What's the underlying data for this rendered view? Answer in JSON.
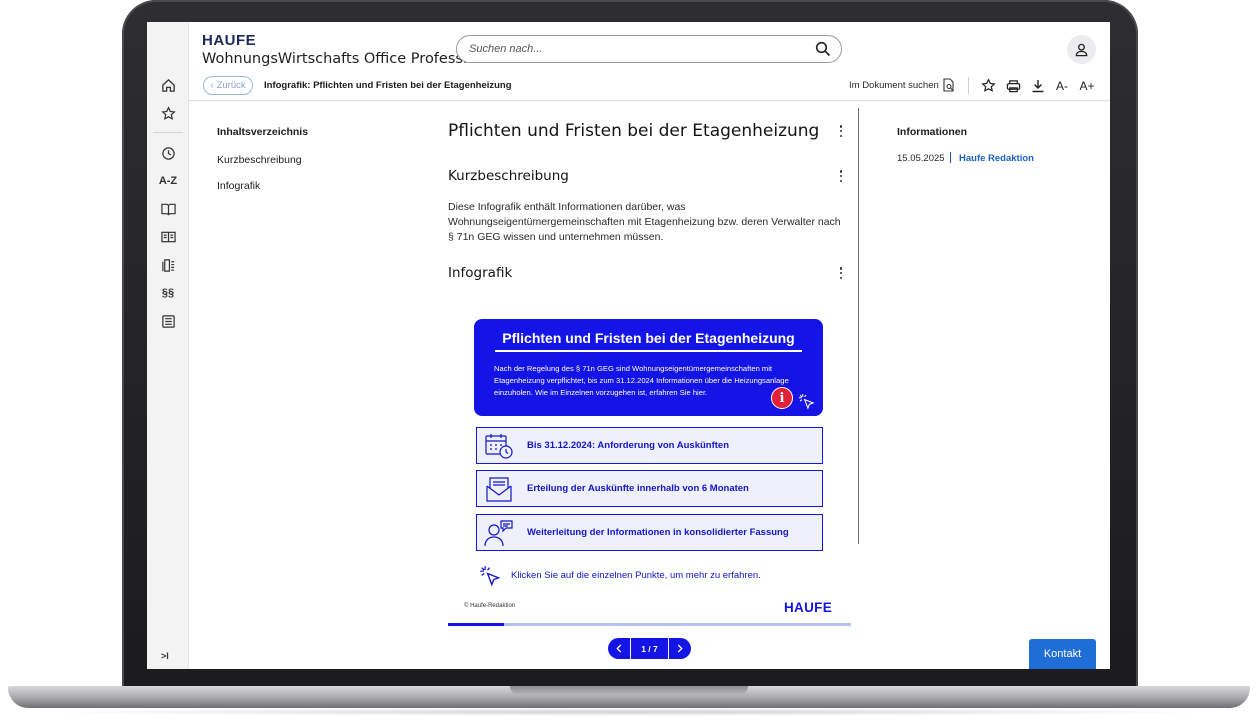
{
  "header": {
    "brand": "HAUFE",
    "product": "WohnungsWirtschafts Office Professional",
    "search_placeholder": "Suchen nach..."
  },
  "rail": {
    "items": [
      "home-icon",
      "star-icon",
      "history-icon",
      "A-Z",
      "book-icon",
      "book-image-icon",
      "document-list-icon",
      "§§",
      "archive-icon"
    ],
    "az_label": "A-Z",
    "paragraph_label": "§§",
    "collapse_label": ">I"
  },
  "toolbar": {
    "back_label": "Zurück",
    "breadcrumb": "Infografik: Pflichten und Fristen bei der Etagenheizung",
    "find_in_document": "Im Dokument suchen",
    "font_smaller": "A-",
    "font_larger": "A+"
  },
  "toc": {
    "title": "Inhaltsverzeichnis",
    "items": [
      "Kurzbeschreibung",
      "Infografik"
    ]
  },
  "article": {
    "title": "Pflichten und Fristen bei der Etagenheizung",
    "section1_title": "Kurzbeschreibung",
    "section1_text": "Diese Infografik enthält Informationen darüber, was Wohnungseigentümergemeinschaften mit Etagenheizung bzw. deren Verwalter nach § 71n GEG wissen und unternehmen müssen.",
    "section2_title": "Infografik"
  },
  "infographic": {
    "title": "Pflichten und Fristen bei der Etagenheizung",
    "intro": "Nach der Regelung des § 71n GEG sind Wohnungseigentümergemeinschaften mit Etagenheizung verpflichtet, bis zum 31.12.2024 Informationen über die Heizungsanlage einzuholen. Wie im Einzelnen vorzugehen ist, erfahren Sie hier.",
    "info_glyph": "i",
    "steps": [
      "Bis 31.12.2024: Anforderung von Auskünften",
      "Erteilung der Auskünfte innerhalb von 6 Monaten",
      "Weiterleitung der Informationen in konsolidierter Fassung"
    ],
    "hint": "Klicken Sie auf die einzelnen Punkte, um mehr zu erfahren.",
    "copyright": "© Haufe-Redaktion",
    "logo": "HAUFE",
    "accent_color": "#1414e6",
    "alert_color": "#e22138",
    "slide_progress": 0.14
  },
  "pager": {
    "label": "1 / 7",
    "current": 1,
    "total": 7
  },
  "info_panel": {
    "title": "Informationen",
    "date": "15.05.2025",
    "author": "Haufe Redaktion"
  },
  "kontakt_label": "Kontakt"
}
